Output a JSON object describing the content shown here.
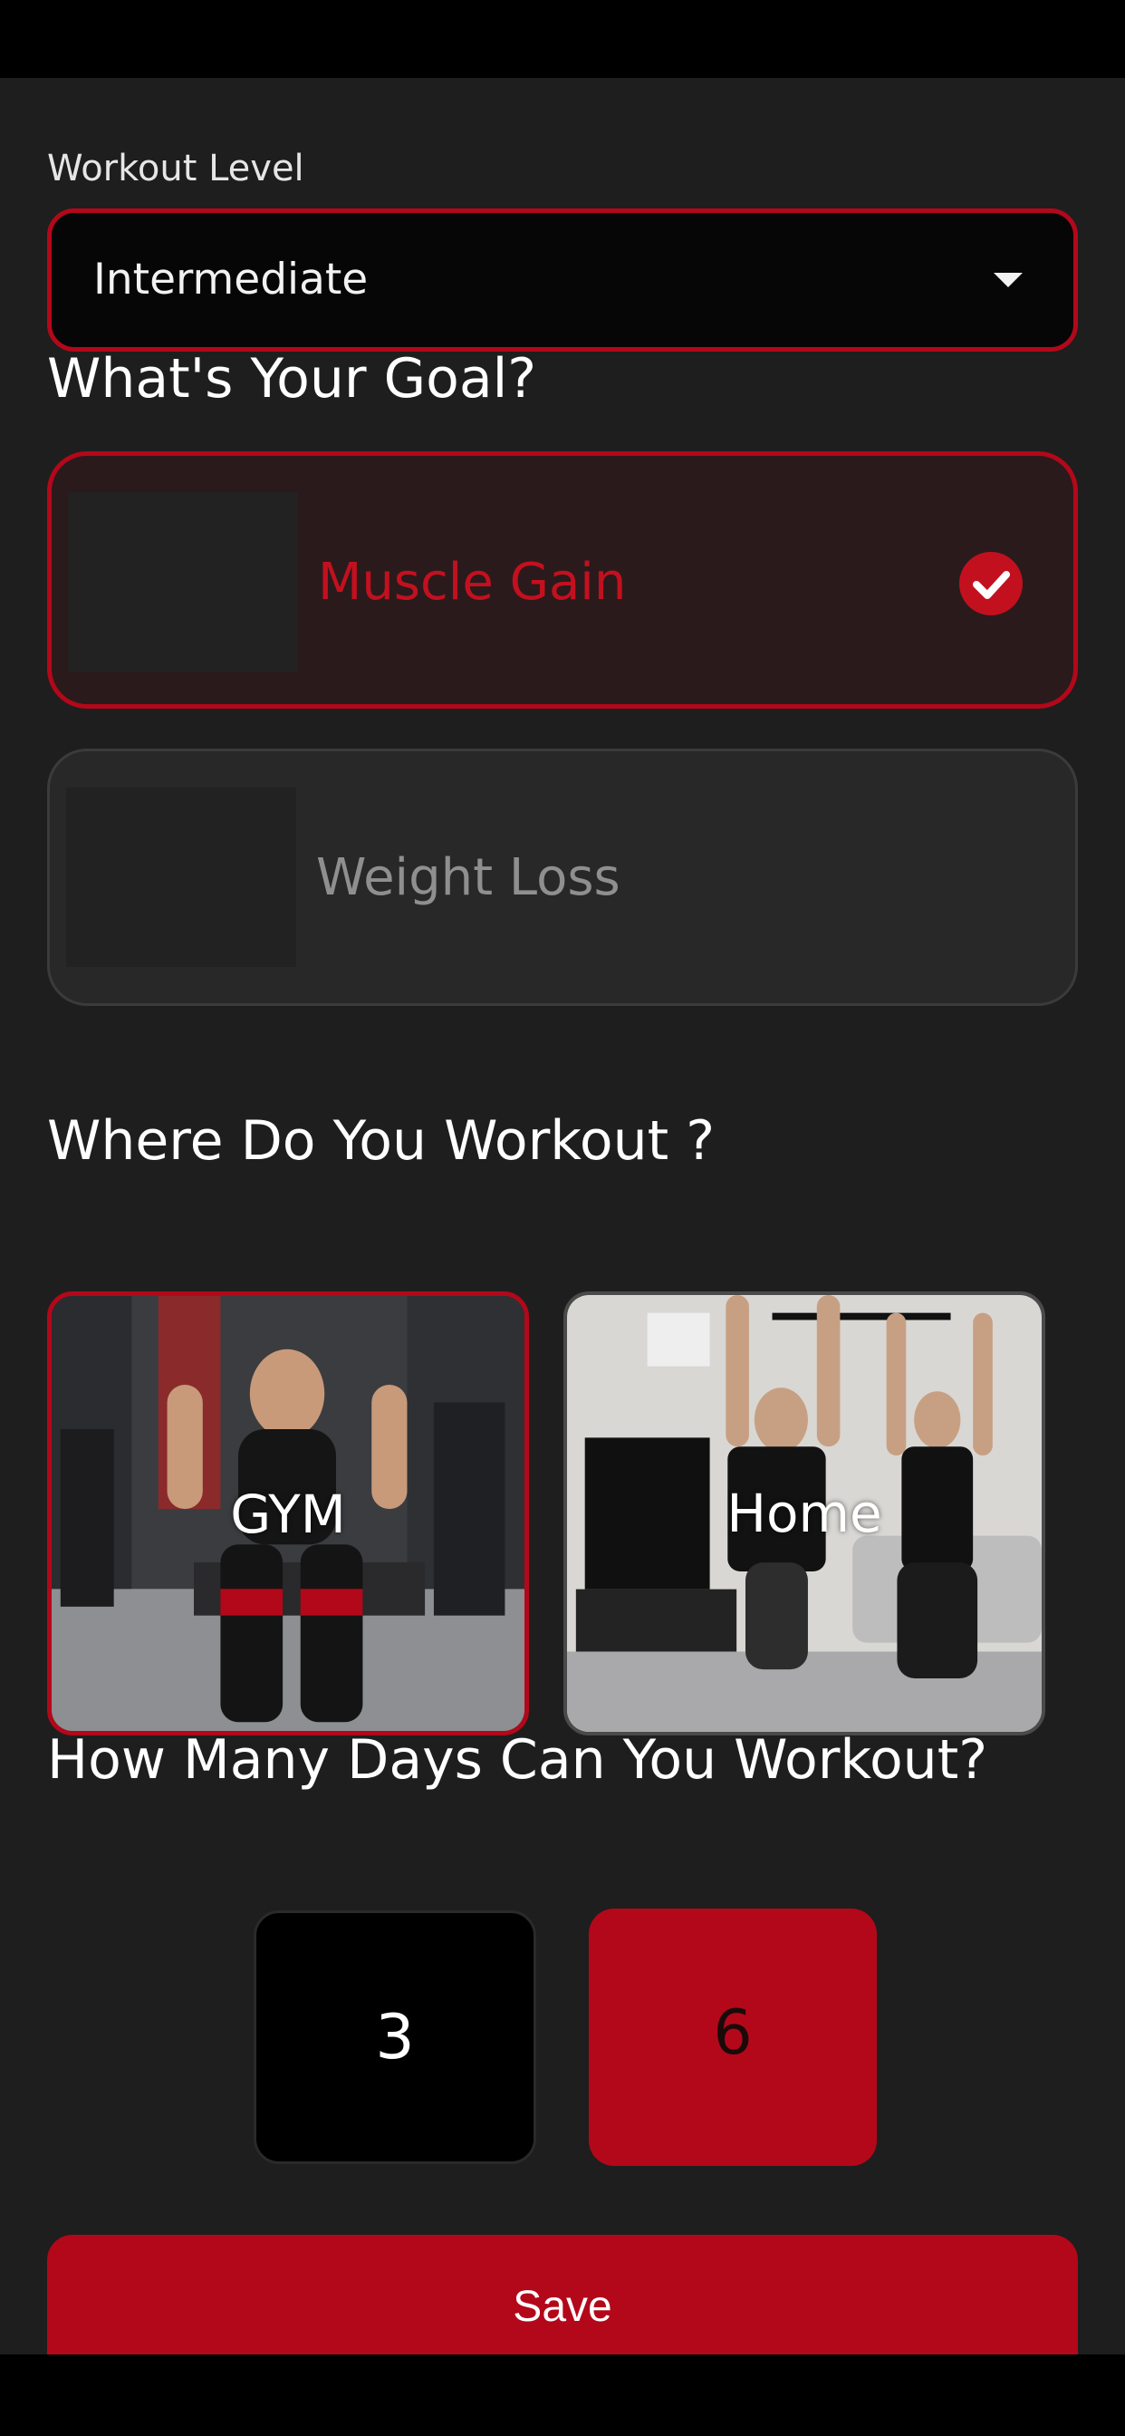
{
  "workout_level": {
    "label": "Workout Level",
    "selected": "Intermediate"
  },
  "goal": {
    "title": "What's Your Goal?",
    "options": [
      {
        "label": "Muscle Gain",
        "selected": true
      },
      {
        "label": "Weight Loss",
        "selected": false
      }
    ]
  },
  "location": {
    "title": "Where Do You Workout ?",
    "options": [
      {
        "label": "GYM",
        "selected": true
      },
      {
        "label": "Home",
        "selected": false
      }
    ]
  },
  "days": {
    "title": "How Many Days Can You Workout?",
    "options": [
      {
        "label": "3",
        "selected": false
      },
      {
        "label": "6",
        "selected": true
      }
    ]
  },
  "save_label": "Save",
  "colors": {
    "accent": "#b3081a",
    "background": "#1e1e1e",
    "card_selected_bg": "#2a1a1c",
    "card_unselected_bg": "#282828"
  },
  "icons": [
    "chevron-down-icon",
    "check-circle-icon"
  ]
}
